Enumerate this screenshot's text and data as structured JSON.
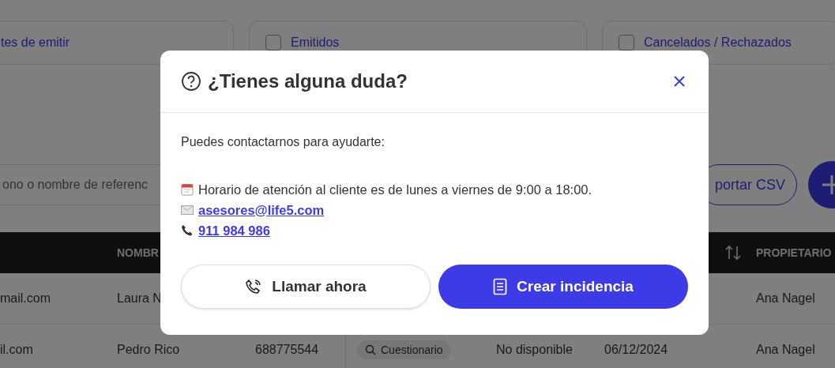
{
  "filters": [
    {
      "kind": "text",
      "label": "tes de emitir"
    },
    {
      "kind": "checkbox",
      "label": "Emitidos",
      "checked": false
    },
    {
      "kind": "checkbox",
      "label": "Cancelados / Rechazados",
      "checked": false
    }
  ],
  "search": {
    "placeholder": "ono o nombre de referenc"
  },
  "export_button": {
    "label": "portar CSV"
  },
  "table": {
    "columns": [
      {
        "kind": "blank"
      },
      {
        "kind": "text",
        "label": "NOMBR"
      },
      {
        "kind": "blank"
      },
      {
        "kind": "blank"
      },
      {
        "kind": "blank"
      },
      {
        "kind": "sort"
      },
      {
        "kind": "text",
        "label": "PROPIETARIO"
      }
    ],
    "rows": [
      {
        "cells": [
          {
            "kind": "text",
            "text": "mail.com"
          },
          {
            "kind": "text",
            "text": "Laura N"
          },
          {
            "kind": "blank"
          },
          {
            "kind": "blank"
          },
          {
            "kind": "blank"
          },
          {
            "kind": "blank"
          },
          {
            "kind": "text",
            "text": "Ana Nagel"
          }
        ]
      },
      {
        "cells": [
          {
            "kind": "text",
            "text": "il.com"
          },
          {
            "kind": "text",
            "text": "Pedro Rico"
          },
          {
            "kind": "text",
            "text": "688775544"
          },
          {
            "kind": "chip",
            "text": "Cuestionario"
          },
          {
            "kind": "text",
            "text": "No disponible"
          },
          {
            "kind": "text",
            "text": "06/12/2024"
          },
          {
            "kind": "text",
            "text": "Ana Nagel"
          }
        ]
      }
    ]
  },
  "modal": {
    "title": "¿Tienes alguna duda?",
    "intro": "Puedes contactarnos para ayudarte:",
    "lines": [
      {
        "kind": "schedule",
        "text": "Horario de atención al cliente es de lunes a viernes de 9:00 a 18:00."
      },
      {
        "kind": "email",
        "text": "asesores@life5.com"
      },
      {
        "kind": "phone",
        "text": "911 984 986"
      }
    ],
    "buttons": [
      {
        "kind": "secondary",
        "label": "Llamar ahora"
      },
      {
        "kind": "primary",
        "label": "Crear incidencia"
      }
    ]
  }
}
